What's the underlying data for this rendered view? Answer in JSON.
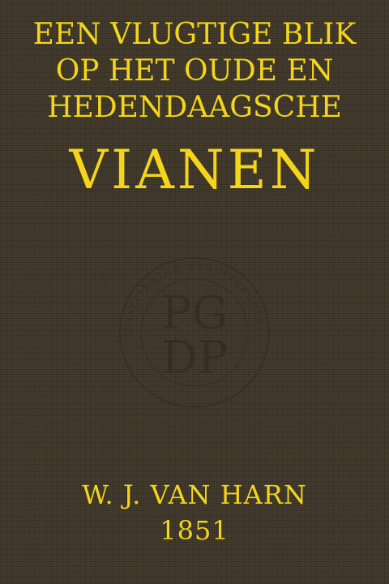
{
  "cover": {
    "title_lines": [
      "EEN VLUGTIGE BLIK",
      "OP HET OUDE EN",
      "HEDENDAAGSCHE"
    ],
    "main_title": "VIANEN",
    "author": "W. J. VAN HARN",
    "year": "1851"
  },
  "seal": {
    "icon": "pgdp-seal-watermark",
    "letters_top": "PG",
    "letters_bottom": "DP",
    "ring_text": "Distributed Proofreaders"
  },
  "colors": {
    "background": "#3d3527",
    "lettering": "#f4d51a",
    "seal": "#2f281d"
  }
}
